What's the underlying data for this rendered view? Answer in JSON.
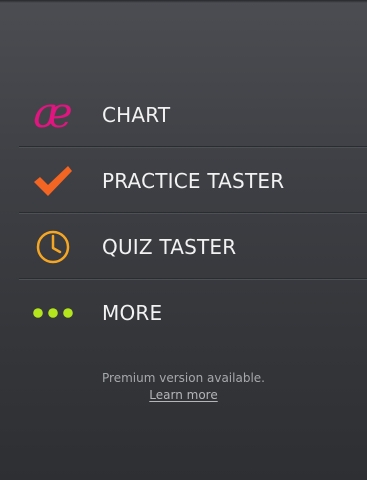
{
  "colors": {
    "chart_icon": "#e0157f",
    "practice_icon": "#f26522",
    "quiz_icon": "#f5a623",
    "more_icon": "#b5e61d",
    "label_text": "#f2f2f2",
    "footer_text": "#a6a8ab"
  },
  "menu": {
    "items": [
      {
        "label": "CHART",
        "icon": "ae-ligature-icon",
        "glyph": "æ"
      },
      {
        "label": "PRACTICE TASTER",
        "icon": "checkmark-icon"
      },
      {
        "label": "QUIZ TASTER",
        "icon": "clock-icon"
      },
      {
        "label": "MORE",
        "icon": "more-dots-icon"
      }
    ]
  },
  "footer": {
    "premium_text": "Premium version available.",
    "learn_more": "Learn more"
  }
}
